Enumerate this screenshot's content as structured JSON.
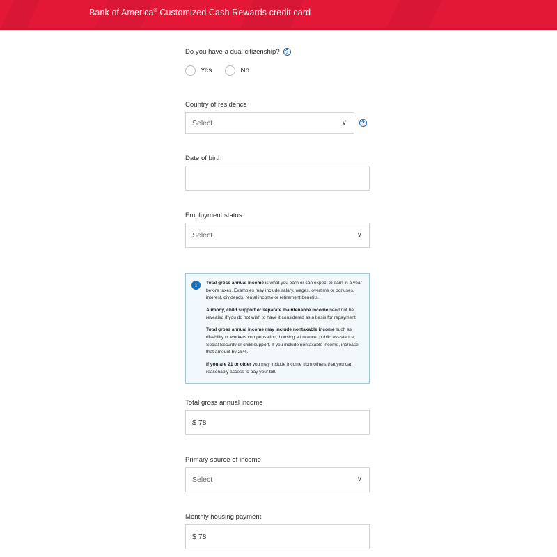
{
  "header": {
    "brand": "Bank of America",
    "registered_mark": "®",
    "product": "Customized Cash Rewards credit card",
    "background_color": "#e31837"
  },
  "icons": {
    "help": "?",
    "info": "i",
    "chevron_down": "∨"
  },
  "form": {
    "dual_citizenship": {
      "question": "Do you have a dual citizenship?",
      "options": [
        {
          "label": "Yes",
          "selected": false
        },
        {
          "label": "No",
          "selected": false
        }
      ]
    },
    "country_of_residence": {
      "label": "Country of residence",
      "value": "Select",
      "has_help": true
    },
    "date_of_birth": {
      "label": "Date of birth",
      "value": "",
      "placeholder": ""
    },
    "employment_status": {
      "label": "Employment status",
      "value": "Select"
    },
    "income_info": {
      "paragraphs": [
        {
          "bold": "Total gross annual income",
          "text": " is what you earn or can expect to earn in a year before taxes. Examples may include salary, wages, overtime or bonuses, interest, dividends, rental income or retirement benefits."
        },
        {
          "bold": "Alimony, child support or separate maintenance income",
          "text": " need not be revealed if you do not wish to have it considered as a basis for repayment."
        },
        {
          "bold": "Total gross annual income may include nontaxable income",
          "text": " such as disability or workers compensation, housing allowance, public assistance, Social Security or child support. If you include nontaxable income, increase that amount by 25%."
        },
        {
          "bold": "If you are 21 or older",
          "text": " you may include income from others that you can reasonably access to pay your bill."
        }
      ]
    },
    "total_gross_annual_income": {
      "label": "Total gross annual income",
      "currency_symbol": "$",
      "value": "78"
    },
    "primary_source_of_income": {
      "label": "Primary source of income",
      "value": "Select"
    },
    "monthly_housing_payment": {
      "label": "Monthly housing payment",
      "currency_symbol": "$",
      "value": "78"
    }
  }
}
